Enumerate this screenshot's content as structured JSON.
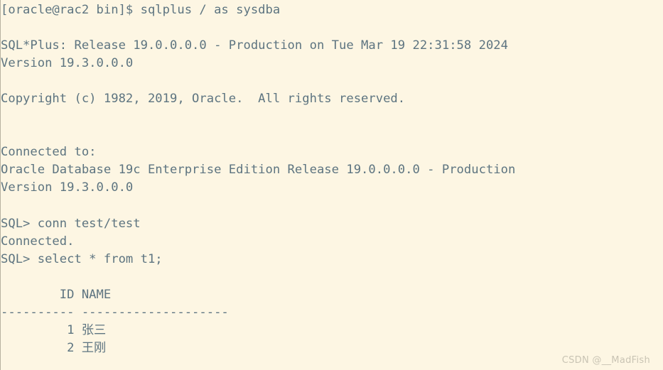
{
  "terminal": {
    "background_color": "#fdf6e3",
    "text_color": "#5d7480",
    "watermark_color": "#c9c4b4",
    "shell_prompt": "[oracle@rac2 bin]$ ",
    "shell_command": "sqlplus / as sysdba",
    "lines": [
      "[oracle@rac2 bin]$ sqlplus / as sysdba",
      "",
      "SQL*Plus: Release 19.0.0.0.0 - Production on Tue Mar 19 22:31:58 2024",
      "Version 19.3.0.0.0",
      "",
      "Copyright (c) 1982, 2019, Oracle.  All rights reserved.",
      "",
      "",
      "Connected to:",
      "Oracle Database 19c Enterprise Edition Release 19.0.0.0.0 - Production",
      "Version 19.3.0.0.0",
      "",
      "SQL> conn test/test",
      "Connected.",
      "SQL> select * from t1;",
      "",
      "        ID NAME",
      "---------- --------------------",
      "         1 张三",
      "         2 王刚"
    ],
    "banner": {
      "product_line": "SQL*Plus: Release 19.0.0.0.0 - Production on Tue Mar 19 22:31:58 2024",
      "product": "SQL*Plus",
      "release": "19.0.0.0.0",
      "edition_tag": "Production",
      "timestamp": "Tue Mar 19 22:31:58 2024",
      "version_line": "Version 19.3.0.0.0",
      "version": "19.3.0.0.0",
      "copyright_line": "Copyright (c) 1982, 2019, Oracle.  All rights reserved."
    },
    "connection": {
      "header": "Connected to:",
      "database_line": "Oracle Database 19c Enterprise Edition Release 19.0.0.0.0 - Production",
      "database_version_line": "Version 19.3.0.0.0"
    },
    "session": {
      "connect_prompt": "SQL> ",
      "connect_command": "conn test/test",
      "connect_line": "SQL> conn test/test",
      "connect_result": "Connected.",
      "query_prompt": "SQL> ",
      "query_command": "select * from t1;",
      "query_line": "SQL> select * from t1;"
    },
    "result_table": {
      "header_line": "        ID NAME",
      "separator_line": "---------- --------------------",
      "columns": [
        "ID",
        "NAME"
      ],
      "rows": [
        {
          "line": "         1 张三",
          "ID": "1",
          "NAME": "张三"
        },
        {
          "line": "         2 王刚",
          "ID": "2",
          "NAME": "王刚"
        }
      ]
    },
    "watermark": "CSDN @__MadFish"
  }
}
